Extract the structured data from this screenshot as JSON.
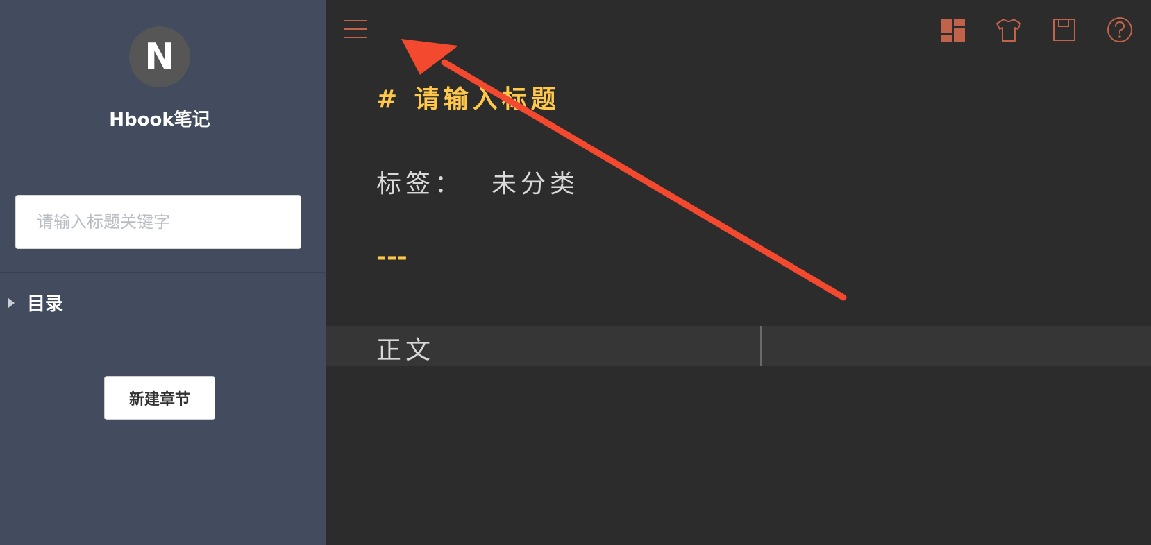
{
  "sidebar": {
    "avatar_letter": "N",
    "app_name": "Hbook笔记",
    "search": {
      "placeholder": "请输入标题关键字",
      "value": ""
    },
    "toc_label": "目录",
    "new_chapter_label": "新建章节"
  },
  "toolbar": {
    "icons": [
      "menu-icon",
      "layout-icon",
      "theme-shirt-icon",
      "save-icon",
      "help-icon"
    ],
    "accent_color": "#c0634a"
  },
  "editor": {
    "title_line": "# 请输入标题",
    "tag_label": "标签：",
    "tag_value": "未分类",
    "hr_line": "---",
    "body_line": "正文",
    "title_color": "#ffc84a",
    "text_color": "#d9d9d9",
    "background": "#2c2c2c"
  },
  "annotation": {
    "arrow_color": "#f2492f"
  }
}
